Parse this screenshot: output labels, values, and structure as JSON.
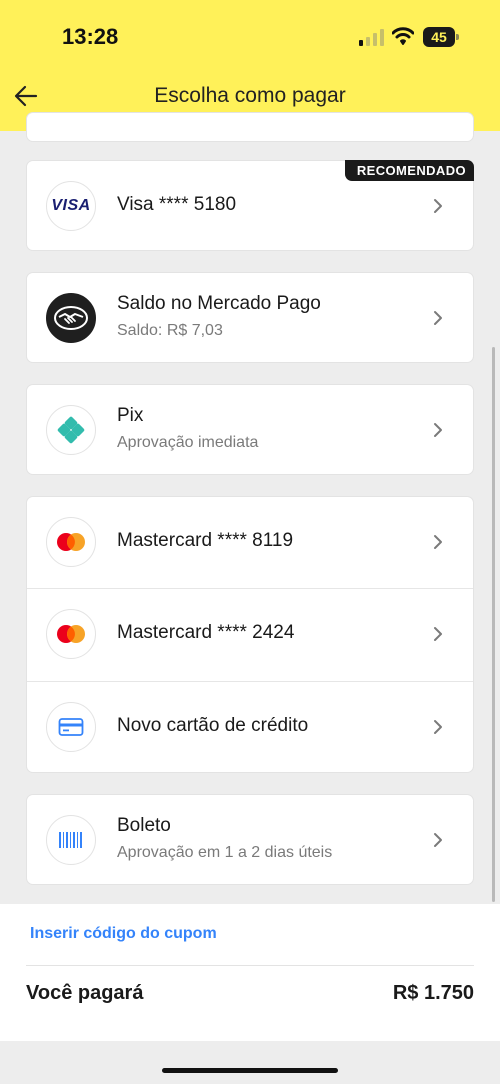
{
  "status_bar": {
    "time": "13:28",
    "battery_level": "45"
  },
  "header": {
    "title": "Escolha como pagar"
  },
  "payment_methods": [
    {
      "title": "Visa **** 5180",
      "badge": "RECOMENDADO",
      "icon": "visa-logo",
      "logo_text": "VISA"
    },
    {
      "title": "Saldo no Mercado Pago",
      "subtitle": "Saldo: R$ 7,03",
      "icon": "mercado-pago-handshake"
    },
    {
      "title": "Pix",
      "subtitle": "Aprovação imediata",
      "icon": "pix-logo"
    },
    {
      "title": "Mastercard **** 8119",
      "icon": "mastercard-logo"
    },
    {
      "title": "Mastercard **** 2424",
      "icon": "mastercard-logo"
    },
    {
      "title": "Novo cartão de crédito",
      "icon": "credit-card-icon"
    },
    {
      "title": "Boleto",
      "subtitle": "Aprovação em 1 a 2 dias úteis",
      "icon": "barcode-icon"
    }
  ],
  "footer": {
    "coupon_link": "Inserir código do cupom",
    "total_label": "Você pagará",
    "total_value": "R$ 1.750"
  },
  "colors": {
    "header_bg": "#fff159",
    "link": "#3483fa",
    "pix": "#32bcad",
    "mastercard_red": "#eb001b",
    "mastercard_orange": "#f79e1b",
    "visa_blue": "#1a1f71",
    "card_icon_blue": "#3483fa"
  }
}
